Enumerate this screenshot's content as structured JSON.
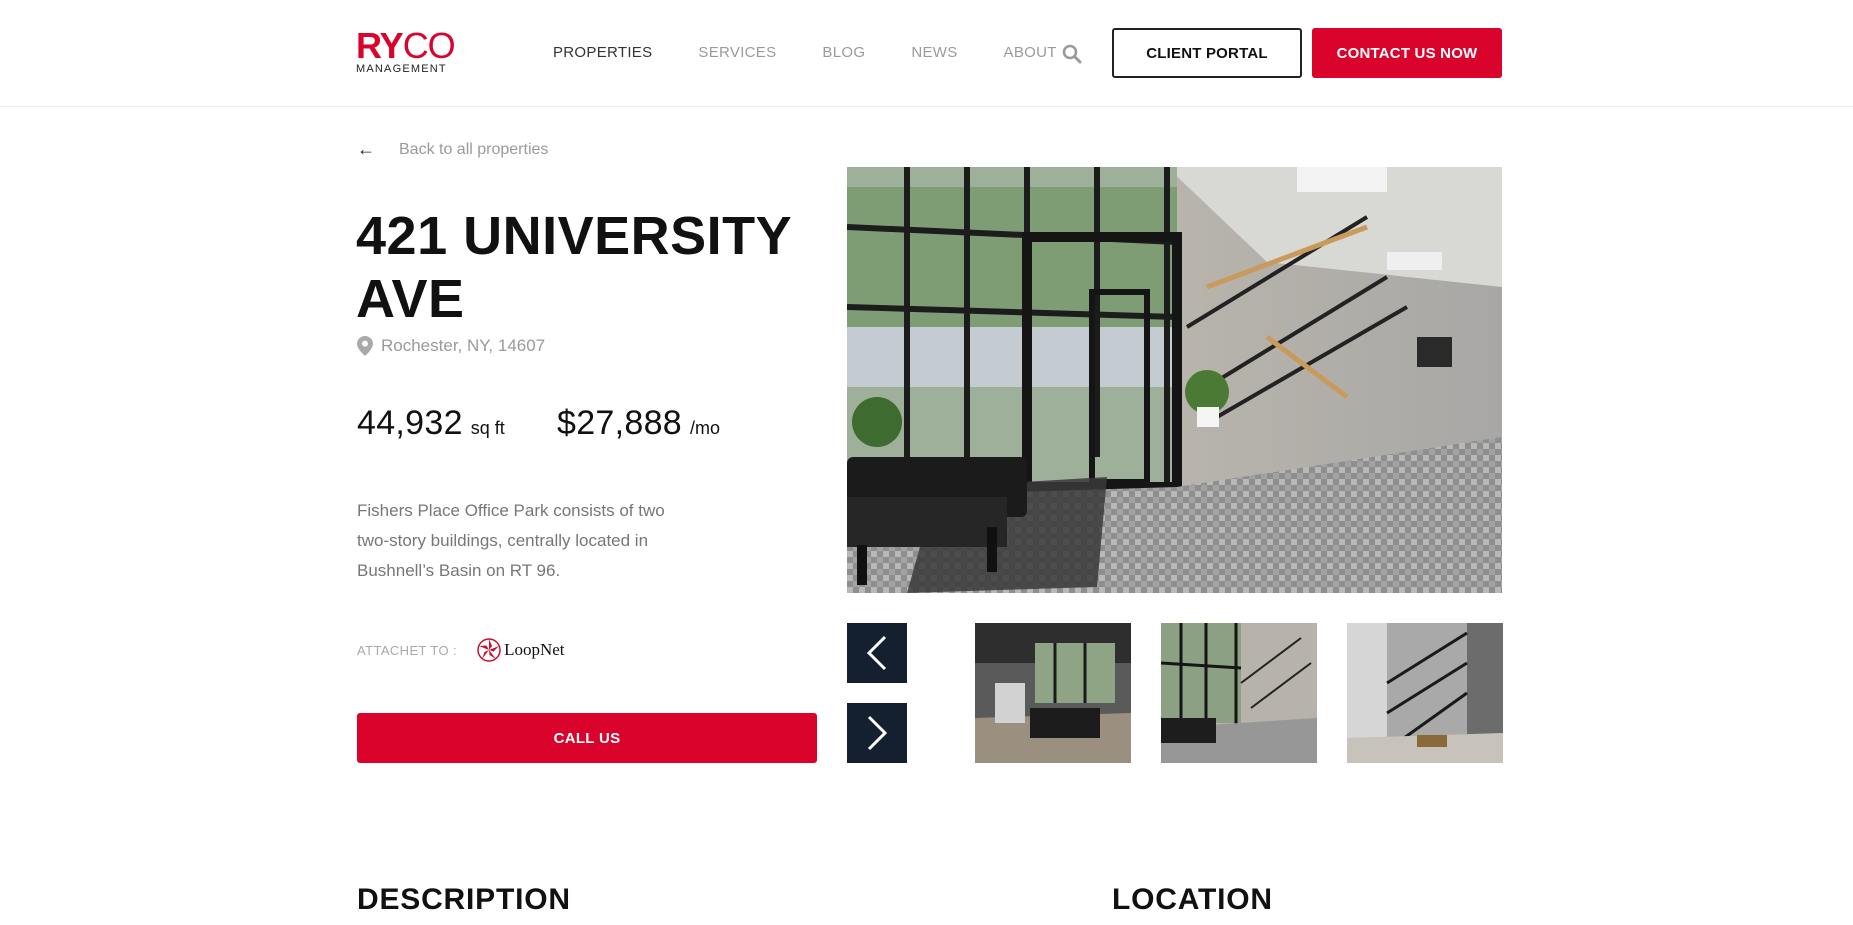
{
  "brand": {
    "logo_red": "RY",
    "logo_co": "CO",
    "logo_sub": "MANAGEMENT",
    "accent": "#d9032b",
    "dark": "#142030"
  },
  "nav": {
    "items": [
      {
        "label": "PROPERTIES",
        "active": true
      },
      {
        "label": "SERVICES"
      },
      {
        "label": "BLOG"
      },
      {
        "label": "NEWS"
      },
      {
        "label": "ABOUT"
      }
    ],
    "search_icon": "search-icon",
    "portal_label": "CLIENT PORTAL",
    "contact_label": "CONTACT US NOW"
  },
  "property": {
    "back_arrow": "←",
    "back_label": "Back to all properties",
    "title": "421 UNIVERSITY AVE",
    "address": "Rochester, NY, 14607",
    "area_value": "44,932",
    "area_unit": "sq ft",
    "price_value": "$27,888",
    "price_unit": "/mo",
    "summary": "Fishers Place Office Park consists of two two-story buildings, centrally located in Bushnell’s Basin on RT 96.",
    "attach_label": "ATTACHET TO :",
    "attach_partner": "LoopNet",
    "call_label": "CALL US"
  },
  "gallery": {
    "prev_icon": "chevron-left-icon",
    "next_icon": "chevron-right-icon",
    "thumb_count": 3
  },
  "sections": {
    "description": "DESCRIPTION",
    "location": "LOCATION"
  }
}
